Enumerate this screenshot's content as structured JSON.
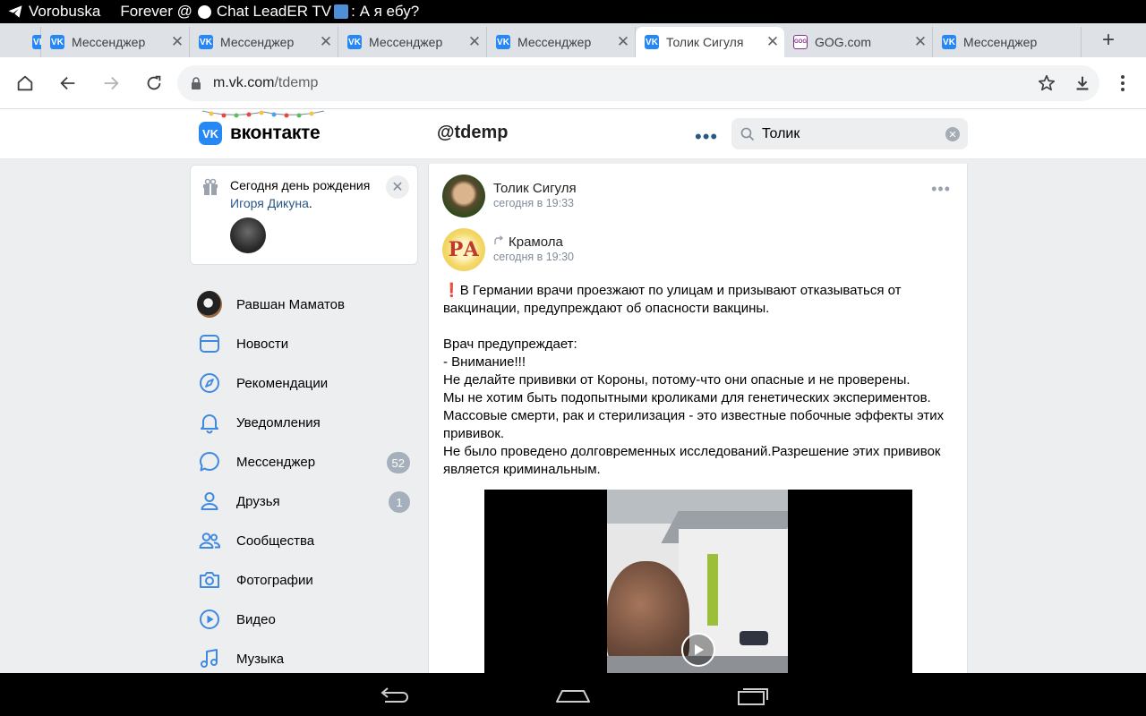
{
  "status_bar": {
    "app_name": "Vorobuska",
    "notification_left": "Forever @",
    "notification_mid": "Chat LeadER TV",
    "notification_right": ": А я ебу?"
  },
  "tabs": [
    {
      "title": "",
      "favicon": "VK",
      "partial": true
    },
    {
      "title": "Мессенджер",
      "favicon": "VK"
    },
    {
      "title": "Мессенджер",
      "favicon": "VK"
    },
    {
      "title": "Мессенджер",
      "favicon": "VK"
    },
    {
      "title": "Мессенджер",
      "favicon": "VK"
    },
    {
      "title": "Толик Сигуля",
      "favicon": "VK",
      "active": true
    },
    {
      "title": "GOG.com",
      "favicon": "GOG"
    },
    {
      "title": "Мессенджер",
      "favicon": "VK"
    }
  ],
  "omnibox": {
    "host": "m.vk.com",
    "path": "/tdemp"
  },
  "header": {
    "logo_text": "вконтакте",
    "logo_mark": "VK",
    "page_title": "@tdemp",
    "search_value": "Толик"
  },
  "birthday": {
    "line1": "Сегодня день рождения",
    "name": "Игоря Дикуна",
    "period": "."
  },
  "nav": [
    {
      "label": "Равшан Маматов",
      "icon": "user-avatar"
    },
    {
      "label": "Новости",
      "icon": "news-icon"
    },
    {
      "label": "Рекомендации",
      "icon": "compass-icon"
    },
    {
      "label": "Уведомления",
      "icon": "bell-icon"
    },
    {
      "label": "Мессенджер",
      "icon": "message-icon",
      "badge": "52"
    },
    {
      "label": "Друзья",
      "icon": "user-icon",
      "badge": "1"
    },
    {
      "label": "Сообщества",
      "icon": "users-icon"
    },
    {
      "label": "Фотографии",
      "icon": "camera-icon"
    },
    {
      "label": "Видео",
      "icon": "video-icon"
    },
    {
      "label": "Музыка",
      "icon": "music-icon"
    }
  ],
  "post": {
    "author": "Толик Сигуля",
    "author_time": "сегодня в 19:33",
    "source": "Крамола",
    "source_time": "сегодня в 19:30",
    "source_avatar_letters": "РА",
    "paragraph1": "В Германии врачи проезжают по улицам и призывают отказываться от вакцинации, предупреждают об опасности вакцины.",
    "body": "Врач предупреждает:\n- Внимание!!!\nНе делайте прививки от Короны, потому-что они опасные и не проверены.\nМы не хотим быть подопытными кроликами для генетических экспериментов.\nМассовые смерти, рак и стерилизация - это известные побочные эффекты этих прививок.\nНе было проведено долговременных исследований.Разрешение этих прививок является криминальным."
  },
  "colors": {
    "vk_blue": "#2787f5",
    "link": "#2a5885",
    "badge": "#a6b0bd",
    "page_bg": "#edeef0",
    "exclamation": "#e0262d"
  }
}
